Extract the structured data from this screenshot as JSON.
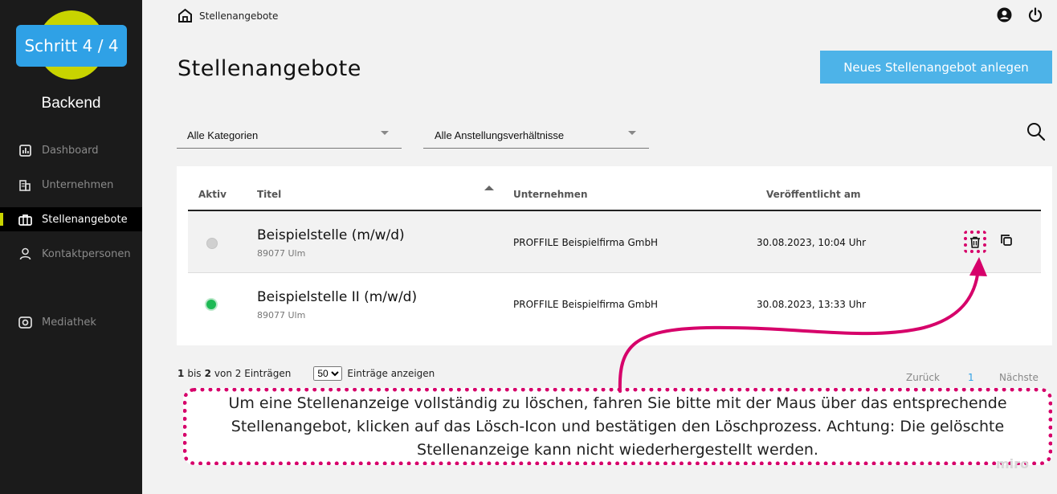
{
  "sidebar": {
    "step_badge": "Schritt 4 / 4",
    "brand": "Backend",
    "items": [
      {
        "label": "Dashboard",
        "icon": "dashboard-icon",
        "active": false
      },
      {
        "label": "Unternehmen",
        "icon": "building-icon",
        "active": false
      },
      {
        "label": "Stellenangebote",
        "icon": "briefcase-icon",
        "active": true
      },
      {
        "label": "Kontaktpersonen",
        "icon": "person-icon",
        "active": false
      },
      {
        "label": "Mediathek",
        "icon": "camera-icon",
        "active": false
      }
    ]
  },
  "header": {
    "breadcrumb": "Stellenangebote",
    "title": "Stellenangebote",
    "new_button": "Neues Stellenangebot anlegen"
  },
  "filters": {
    "category": "Alle Kategorien",
    "employment": "Alle Anstellungsverhältnisse"
  },
  "table": {
    "columns": [
      "Aktiv",
      "Titel",
      "Unternehmen",
      "Veröffentlicht am"
    ],
    "rows": [
      {
        "title": "Beispielstelle (m/w/d)",
        "location": "89077 Ulm",
        "company": "PROFFILE Beispielfirma GmbH",
        "date": "30.08.2023, 10:04 Uhr",
        "active": false
      },
      {
        "title": "Beispielstelle II (m/w/d)",
        "location": "89077 Ulm",
        "company": "PROFFILE Beispielfirma GmbH",
        "date": "30.08.2023, 13:33 Uhr",
        "active": true
      }
    ]
  },
  "footer": {
    "from": "1",
    "bis": "bis",
    "to": "2",
    "von_text": "von 2 Einträgen",
    "page_size": "50",
    "page_size_label": "Einträge anzeigen",
    "prev": "Zurück",
    "current_page": "1",
    "next": "Nächste"
  },
  "callout": {
    "text": "Um eine Stellenanzeige vollständig zu löschen, fahren Sie bitte mit der Maus über das entsprechende Stellenangebot, klicken auf das Lösch-Icon und bestätigen den Löschprozess. Achtung: Die gelöschte Stellenanzeige kann nicht wiederhergestellt werden."
  },
  "watermark": "miro",
  "colors": {
    "accent_blue": "#2fa1e6",
    "button_blue": "#4db3e8",
    "brand_lime": "#c8d400",
    "callout_magenta": "#d6006a",
    "active_green": "#1db954",
    "inactive_grey": "#d0d0d0"
  }
}
